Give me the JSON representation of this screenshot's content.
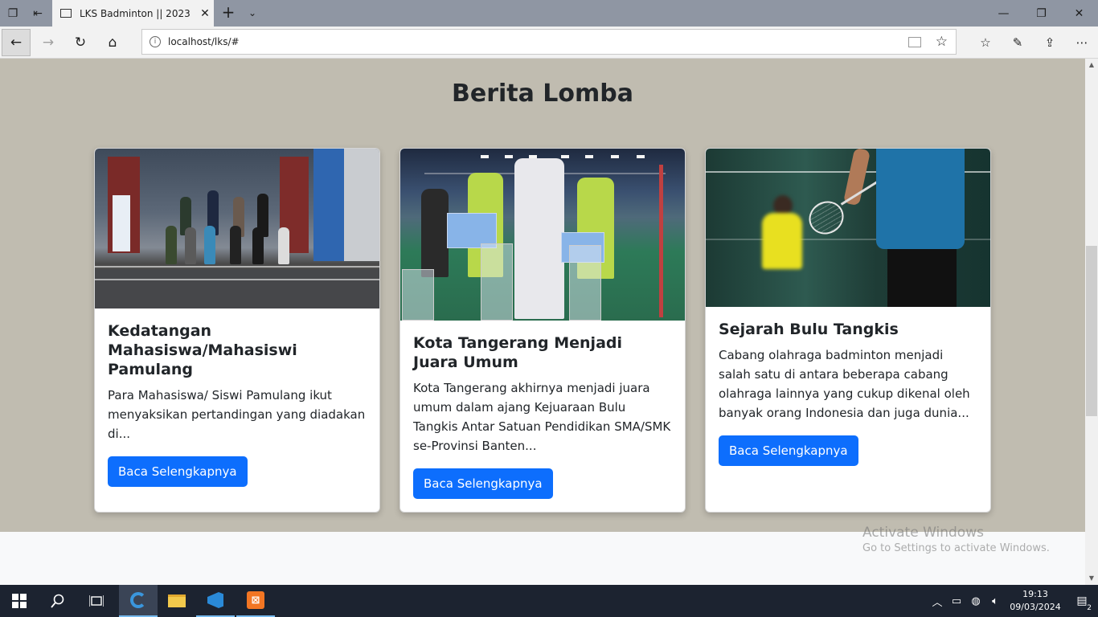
{
  "browser": {
    "tab_title": "LKS Badminton || 2023",
    "url": "localhost/lks/#"
  },
  "page": {
    "section_title": "Berita Lomba",
    "cards": [
      {
        "title": "Kedatangan Mahasiswa/Mahasiswi Pamulang",
        "text": "Para Mahasiswa/ Siswi Pamulang ikut menyaksikan pertandingan yang diadakan di...",
        "button_label": "Baca Selengkapnya"
      },
      {
        "title": "Kota Tangerang Menjadi Juara Umum",
        "text": "Kota Tangerang akhirnya menjadi juara umum dalam ajang Kejuaraan Bulu Tangkis Antar Satuan Pendidikan SMA/SMK se-Provinsi Banten...",
        "button_label": "Baca Selengkapnya"
      },
      {
        "title": "Sejarah Bulu Tangkis",
        "text": "Cabang olahraga badminton menjadi salah satu di antara beberapa cabang olahraga lainnya yang cukup dikenal oleh banyak orang Indonesia dan juga dunia...",
        "button_label": "Baca Selengkapnya"
      }
    ]
  },
  "watermark": {
    "line1": "Activate Windows",
    "line2": "Go to Settings to activate Windows."
  },
  "taskbar": {
    "time": "19:13",
    "date": "09/03/2024",
    "notification_count": "2",
    "apps": [
      "windows-start",
      "search",
      "task-view",
      "edge",
      "file-explorer",
      "vscode",
      "xampp"
    ]
  },
  "colors": {
    "section_bg": "#c0bcb0",
    "button_primary": "#0d6efd",
    "taskbar_bg": "#1c2330"
  }
}
